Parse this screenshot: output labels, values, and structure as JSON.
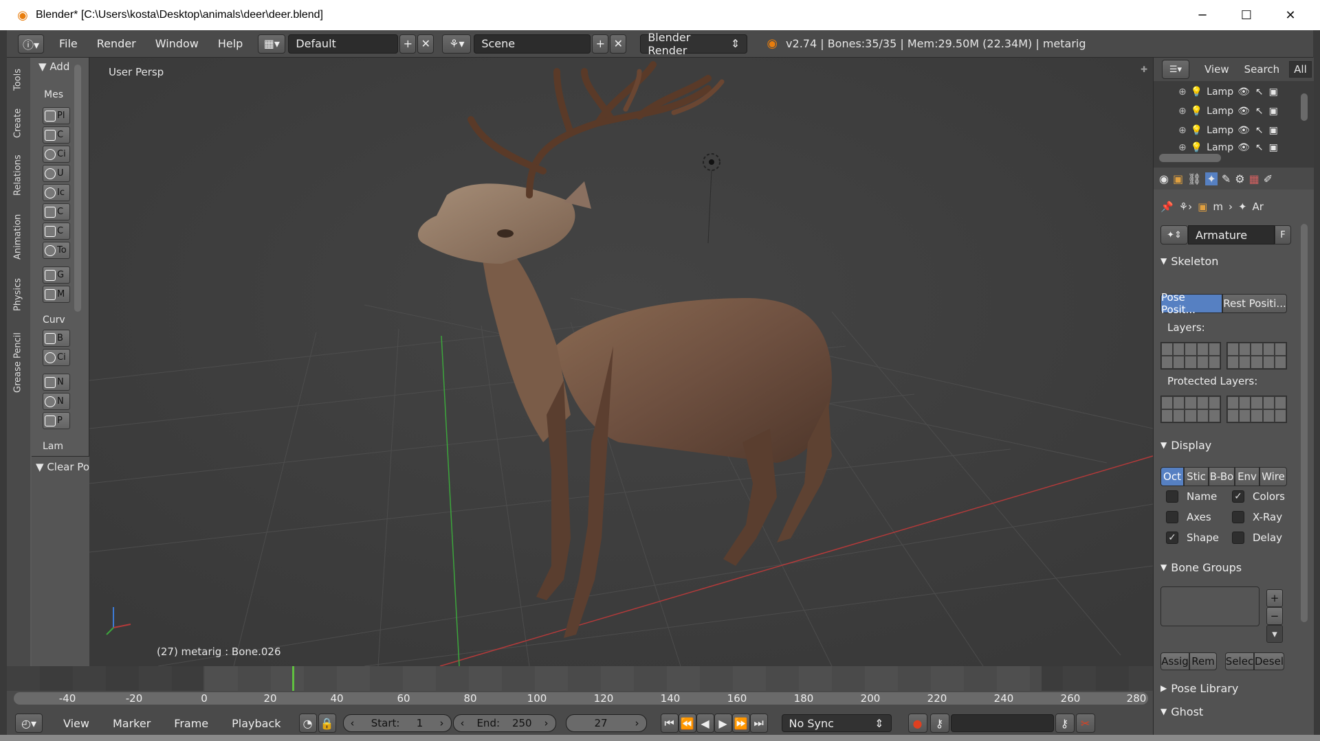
{
  "window": {
    "title": "Blender* [C:\\Users\\kosta\\Desktop\\animals\\deer\\deer.blend]"
  },
  "menubar": {
    "menus": [
      "File",
      "Render",
      "Window",
      "Help"
    ],
    "layout_name": "Default",
    "scene_name": "Scene",
    "render_engine": "Blender Render",
    "stats": "v2.74 | Bones:35/35 | Mem:29.50M (22.34M) | metarig"
  },
  "tools": {
    "tabs": [
      "Tools",
      "Create",
      "Relations",
      "Animation",
      "Physics",
      "Grease Pencil"
    ],
    "add_header": "Add",
    "mesh_label": "Mes",
    "mesh_items": [
      "Pl",
      "C",
      "Ci",
      "U",
      "Ic",
      "C",
      "C",
      "To",
      "G",
      "M"
    ],
    "curve_label": "Curv",
    "curve_items": [
      "B",
      "Ci",
      "N",
      "N",
      "P"
    ],
    "lamp_label": "Lam",
    "clear_pose": "Clear Pose"
  },
  "viewport": {
    "view_label": "User Persp",
    "status": "(27) metarig : Bone.026"
  },
  "timeline": {
    "ticks": [
      "-40",
      "-20",
      "0",
      "20",
      "40",
      "60",
      "80",
      "100",
      "120",
      "140",
      "160",
      "180",
      "200",
      "220",
      "240",
      "260",
      "280"
    ],
    "current_frame": 27
  },
  "bottombar": {
    "menus": [
      "View",
      "Marker",
      "Frame",
      "Playback"
    ],
    "start_label": "Start:",
    "start_value": "1",
    "end_label": "End:",
    "end_value": "250",
    "current": "27",
    "sync": "No Sync"
  },
  "outliner": {
    "menus": [
      "View",
      "Search",
      "All"
    ],
    "items": [
      "Lamp",
      "Lamp",
      "Lamp",
      "Lamp"
    ]
  },
  "properties": {
    "breadcrumb": [
      "m",
      "Ar"
    ],
    "datablock": "Armature",
    "fake_user": "F",
    "skeleton": {
      "header": "Skeleton",
      "pose_position": "Pose Posit...",
      "rest_position": "Rest Positi...",
      "layers_label": "Layers:",
      "protected_label": "Protected Layers:"
    },
    "display": {
      "header": "Display",
      "modes": [
        "Oct",
        "Stic",
        "B-Bo",
        "Env",
        "Wire"
      ],
      "active_mode": "Oct",
      "options": [
        {
          "label": "Name",
          "checked": false
        },
        {
          "label": "Colors",
          "checked": true
        },
        {
          "label": "Axes",
          "checked": false
        },
        {
          "label": "X-Ray",
          "checked": false
        },
        {
          "label": "Shape",
          "checked": true
        },
        {
          "label": "Delay",
          "checked": false
        }
      ]
    },
    "bone_groups": {
      "header": "Bone Groups",
      "buttons": [
        "Assig",
        "Rem",
        "Selec",
        "Desel"
      ]
    },
    "pose_library": "Pose Library",
    "ghost": "Ghost"
  },
  "colors": {
    "accent": "#5680c2",
    "orange": "#e87d0d",
    "x_axis": "#b43a3a",
    "y_axis": "#3ca63c"
  }
}
